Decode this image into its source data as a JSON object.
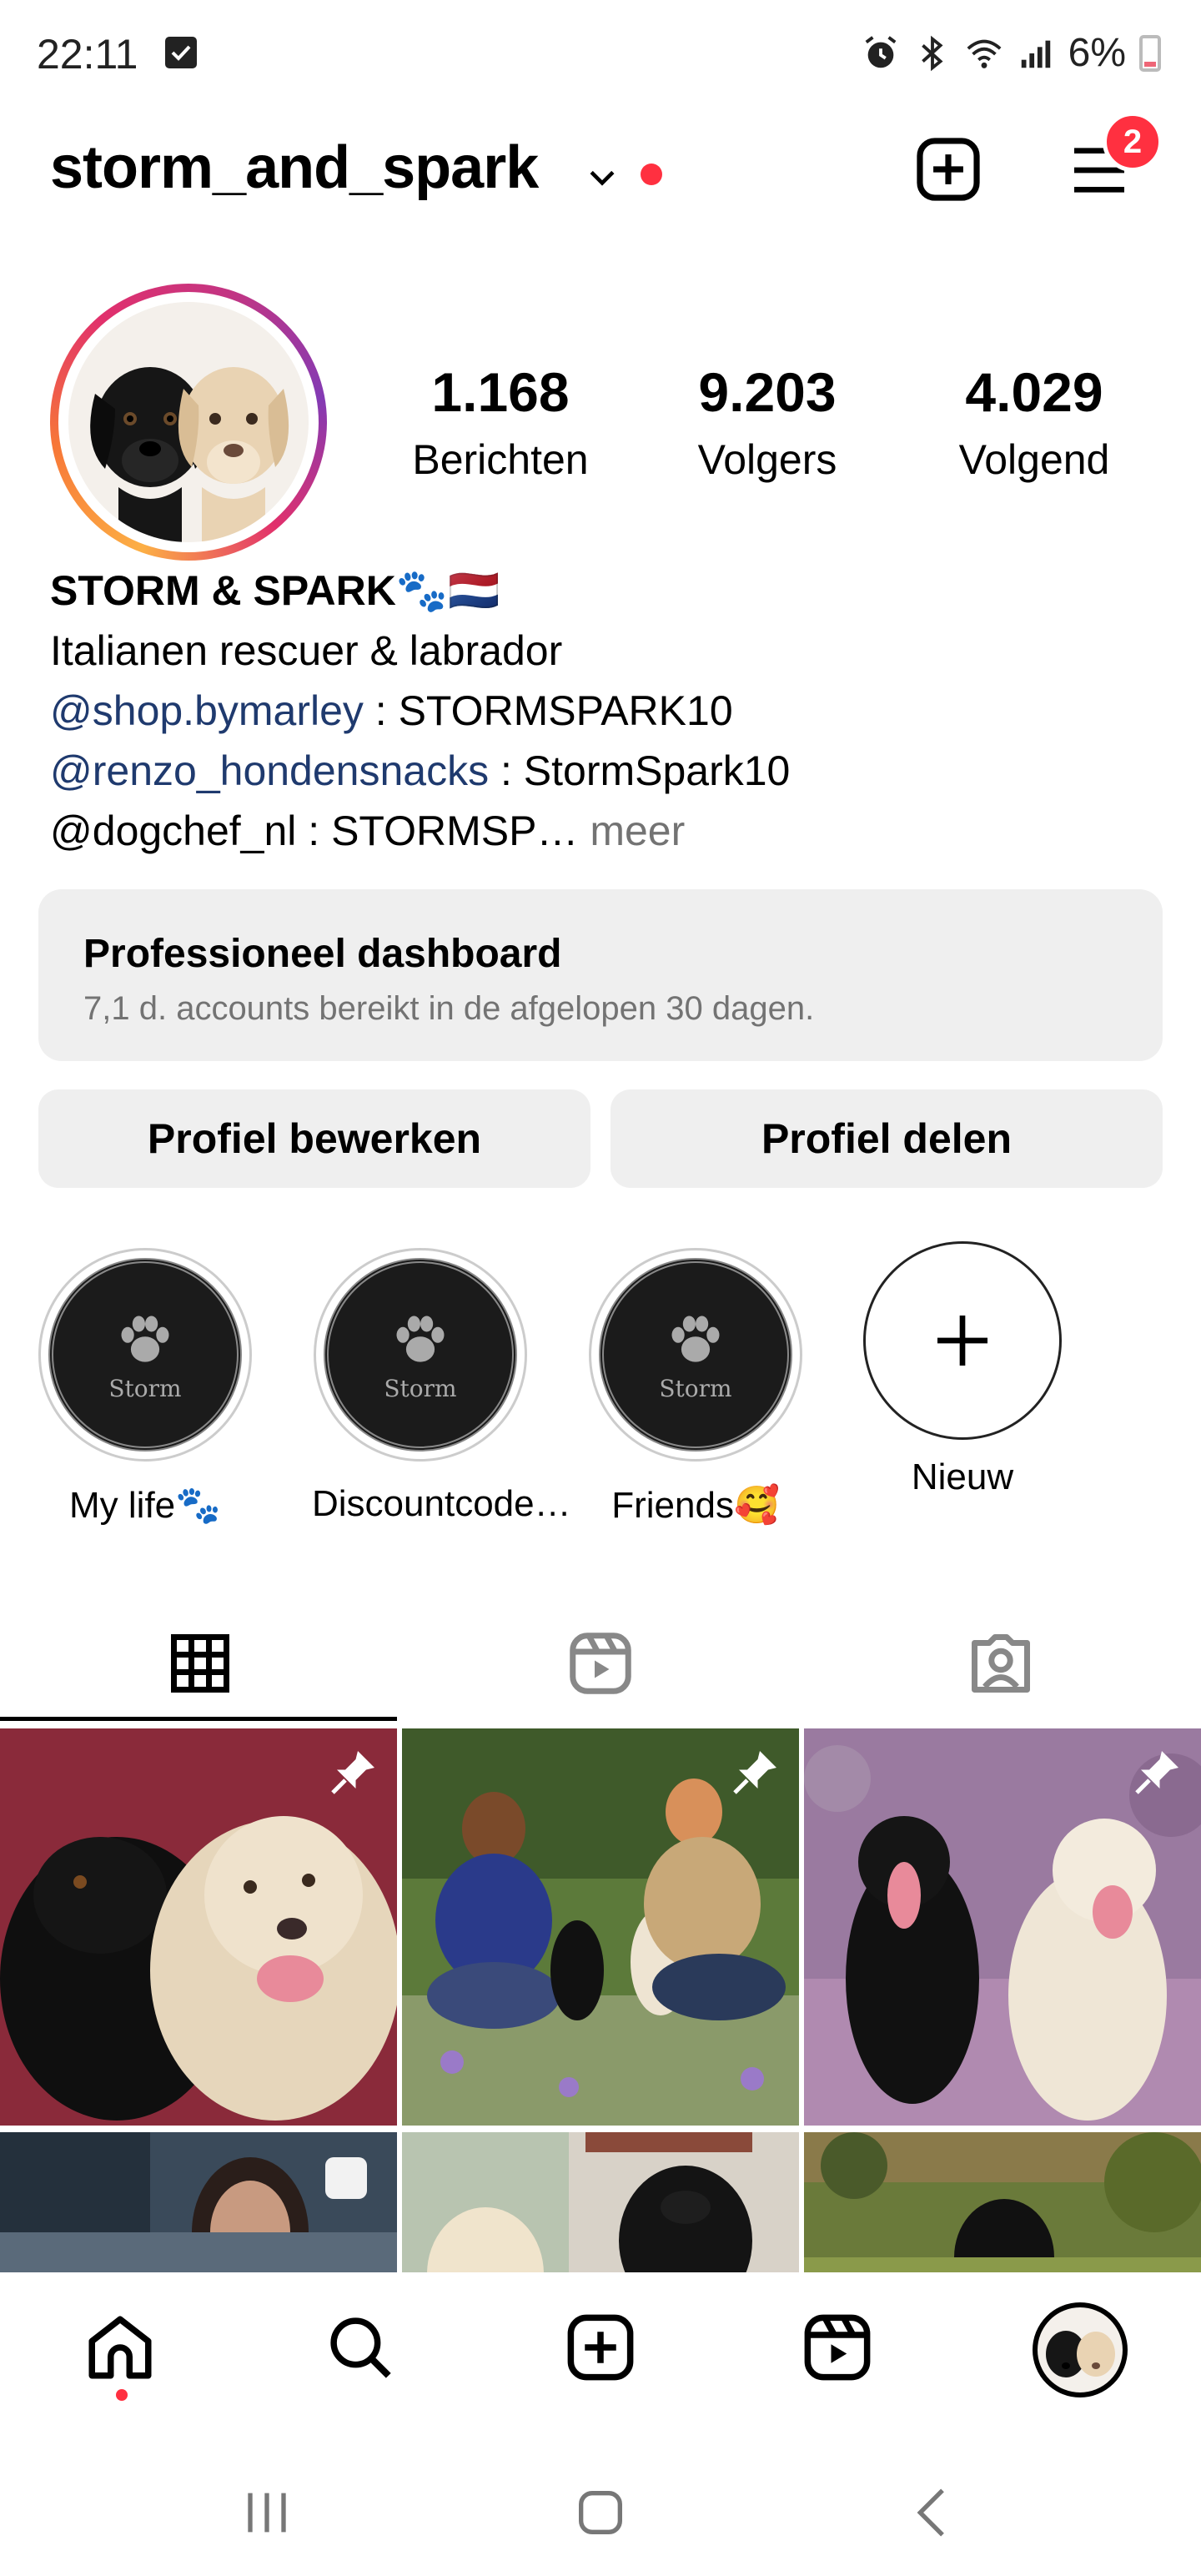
{
  "status_bar": {
    "time": "22:11",
    "battery": "6%"
  },
  "header": {
    "username": "storm_and_spark",
    "notification_count": "2"
  },
  "profile": {
    "stats": [
      {
        "value": "1.168",
        "label": "Berichten"
      },
      {
        "value": "9.203",
        "label": "Volgers"
      },
      {
        "value": "4.029",
        "label": "Volgend"
      }
    ],
    "bio": {
      "name": "STORM & SPARK🐾🇳🇱",
      "line1": "Italianen rescuer & labrador",
      "line2_link": "@shop.bymarley",
      "line2_text": " : STORMSPARK10",
      "line3_link": "@renzo_hondensnacks",
      "line3_text": " : StormSpark10",
      "line4_text": "@dogchef_nl : STORMSP…",
      "more": " meer"
    }
  },
  "dashboard": {
    "title": "Professioneel dashboard",
    "subtitle": "7,1 d. accounts bereikt in de afgelopen 30 dagen."
  },
  "buttons": {
    "edit": "Profiel bewerken",
    "share": "Profiel delen"
  },
  "highlights": [
    {
      "label": "My life🐾",
      "badge_text": "Storm"
    },
    {
      "label": "Discountcode…",
      "badge_text": "Storm"
    },
    {
      "label": "Friends🥰",
      "badge_text": "Storm"
    },
    {
      "label": "Nieuw"
    }
  ],
  "tabs": [
    {
      "name": "posts-grid",
      "active": true
    },
    {
      "name": "reels",
      "active": false
    },
    {
      "name": "tagged",
      "active": false
    }
  ],
  "colors": {
    "accent_red": "#ff3040",
    "link": "#1f3a6e",
    "muted": "#737373",
    "button_bg": "#efefef"
  }
}
